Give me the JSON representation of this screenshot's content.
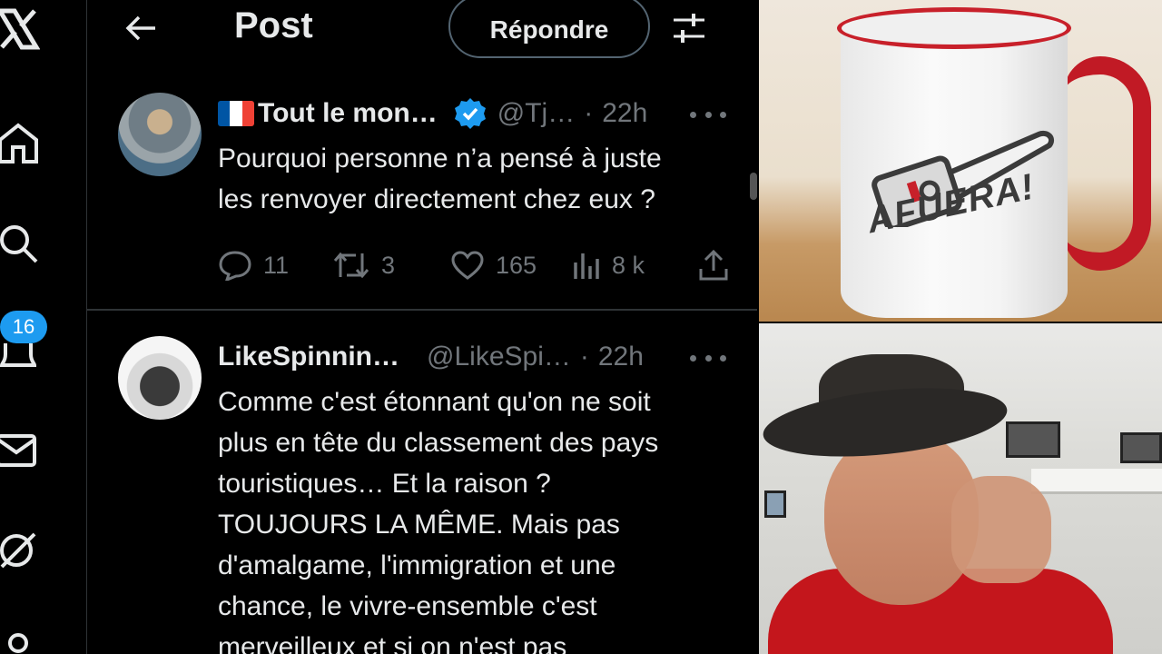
{
  "nav": {
    "icons": [
      "x-logo-icon",
      "home-icon",
      "search-icon",
      "notifications-icon",
      "messages-icon",
      "grok-icon",
      "profile-icon"
    ],
    "notifications_badge": "16"
  },
  "header": {
    "title": "Post",
    "reply_label": "Répondre"
  },
  "posts": [
    {
      "name": "Tout le mon…",
      "flag": "france",
      "verified": true,
      "handle": "@Tj…",
      "separator": "·",
      "time": "22h",
      "text_lines": [
        "Pourquoi personne n’a pensé à juste",
        "les renvoyer directement chez eux ?"
      ],
      "stats": {
        "replies": "11",
        "reposts": "3",
        "likes": "165",
        "views": "8 k"
      }
    },
    {
      "name": "LikeSpinnin…",
      "verified": false,
      "handle": "@LikeSpi…",
      "separator": "·",
      "time": "22h",
      "text_lines": [
        "Comme c'est étonnant qu'on ne soit",
        "plus en tête du classement des pays",
        "touristiques… Et la raison ?",
        "TOUJOURS LA MÊME. Mais pas",
        "d'amalgame, l'immigration et une",
        "chance, le vivre-ensemble c'est",
        "merveilleux et si on n'est pas"
      ]
    }
  ],
  "mug": {
    "logo_text": "AFUERA!"
  },
  "colors": {
    "accent": "#1d9bf0",
    "muted": "#71767b",
    "text": "#e7e9ea",
    "mug_red": "#c8202a",
    "shirt_red": "#c4161c"
  }
}
